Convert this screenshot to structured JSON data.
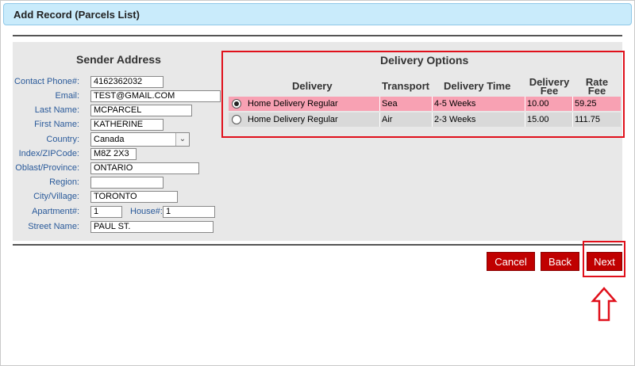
{
  "header": {
    "title": "Add Record (Parcels List)"
  },
  "sender": {
    "title": "Sender Address",
    "labels": {
      "phone": "Contact Phone#:",
      "email": "Email:",
      "last_name": "Last Name:",
      "first_name": "First Name:",
      "country": "Country:",
      "zip": "Index/ZIPCode:",
      "province": "Oblast/Province:",
      "region": "Region:",
      "city": "City/Village:",
      "apartment": "Apartment#:",
      "house": "House#:",
      "street": "Street Name:"
    },
    "values": {
      "phone": "4162362032",
      "email": "TEST@GMAIL.COM",
      "last_name": "MCPARCEL",
      "first_name": "KATHERINE",
      "country": "Canada",
      "zip": "M8Z 2X3",
      "province": "ONTARIO",
      "region": "",
      "city": "TORONTO",
      "apartment": "1",
      "house": "1",
      "street": "PAUL ST."
    }
  },
  "delivery": {
    "title": "Delivery Options",
    "columns": {
      "delivery": "Delivery",
      "transport": "Transport",
      "time": "Delivery Time",
      "fee_line1": "Delivery",
      "fee_line2": "Fee",
      "rate_line1": "Rate",
      "rate_line2": "Fee"
    },
    "rows": [
      {
        "selected": true,
        "delivery": "Home Delivery Regular",
        "transport": "Sea",
        "time": "4-5 Weeks",
        "fee": "10.00",
        "rate": "59.25"
      },
      {
        "selected": false,
        "delivery": "Home Delivery Regular",
        "transport": "Air",
        "time": "2-3 Weeks",
        "fee": "15.00",
        "rate": "111.75"
      }
    ]
  },
  "buttons": {
    "cancel": "Cancel",
    "back": "Back",
    "next": "Next"
  },
  "colors": {
    "header_bg": "#c9ebfb",
    "button_red": "#c00000",
    "selected_row": "#f8a1b3",
    "annotation_red": "#e0101b"
  },
  "icons": {
    "dropdown": "chevron-down-icon",
    "pointer": "up-arrow-icon"
  }
}
